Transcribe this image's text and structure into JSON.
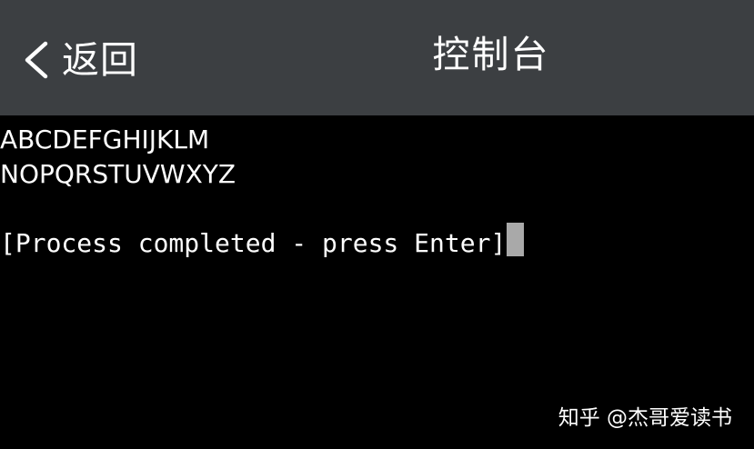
{
  "header": {
    "back_label": "返回",
    "title": "控制台",
    "background": "#3c3f42"
  },
  "terminal": {
    "lines": [
      "ABCDEFGHIJKLM",
      "NOPQRSTUVWXYZ",
      "",
      "[Process completed - press Enter]"
    ],
    "cursor_color": "#a9a9a9",
    "background": "#000000",
    "text_color": "#ffffff"
  },
  "watermark": {
    "text": "知乎 @杰哥爱读书"
  },
  "icons": {
    "back": "chevron-left-icon"
  }
}
